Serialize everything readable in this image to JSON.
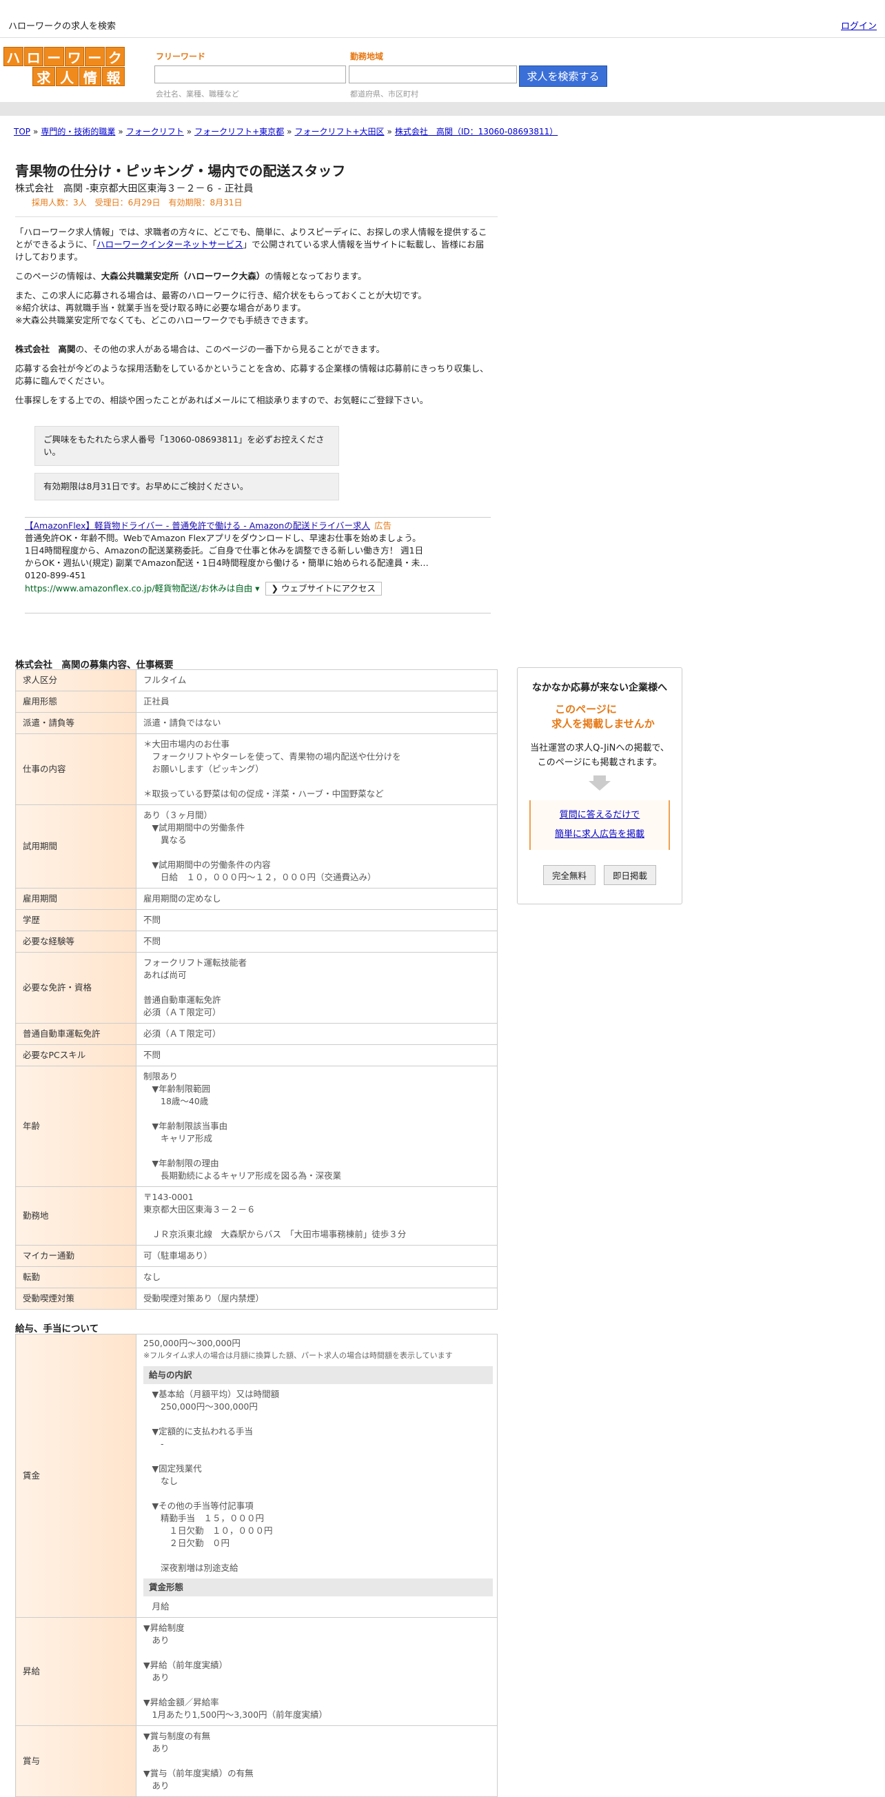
{
  "topbar": {
    "site_title": "ハローワークの求人を検索",
    "login": "ログイン"
  },
  "logo": {
    "row1": [
      "ハ",
      "ロ",
      "ー",
      "ワ",
      "ー",
      "ク"
    ],
    "row2": [
      "求",
      "人",
      "情",
      "報"
    ]
  },
  "search": {
    "freeword_label": "フリーワード",
    "freeword_hint": "会社名、業種、職種など",
    "area_label": "勤務地域",
    "area_hint": "都道府県、市区町村",
    "button": "求人を検索する"
  },
  "breadcrumb": [
    "TOP",
    "専門的・技術的職業",
    "フォークリフト",
    "フォークリフト+東京都",
    "フォークリフト+大田区",
    "株式会社　高関（ID：13060-08693811）"
  ],
  "job": {
    "title": "青果物の仕分け・ピッキング・場内での配送スタッフ",
    "subtitle": "株式会社　高関 -東京都大田区東海３－２－６ - 正社員",
    "meta": "採用人数：3人　受理日：6月29日　有効期限：8月31日"
  },
  "intro": {
    "p1a": "「ハローワーク求人情報」では、求職者の方々に、どこでも、簡単に、よりスピーディに、お探しの求人情報を提供することができるように、「",
    "p1link": "ハローワークインターネットサービス",
    "p1b": "」で公開されている求人情報を当サイトに転載し、皆様にお届けしております。",
    "p2a": "このページの情報は、",
    "p2bold": "大森公共職業安定所（ハローワーク大森）",
    "p2b": "の情報となっております。",
    "p3": "また、この求人に応募される場合は、最寄のハローワークに行き、紹介状をもらっておくことが大切です。",
    "p3b": "※紹介状は、再就職手当・就業手当を受け取る時に必要な場合があります。",
    "p3c": "※大森公共職業安定所でなくても、どこのハローワークでも手続きできます。",
    "p4bold": "株式会社　高関",
    "p4": "の、その他の求人がある場合は、このページの一番下から見ることができます。",
    "p5": "応募する会社が今どのような採用活動をしているかということを含め、応募する企業様の情報は応募前にきっちり収集し、応募に臨んでください。",
    "p6": "仕事探しをする上での、相談や困ったことがあればメールにて相談承りますので、お気軽にご登録下さい。"
  },
  "notes": {
    "n1": "ご興味をもたれたら求人番号「13060-08693811」を必ずお控えください。",
    "n2": "有効期限は8月31日です。お早めにご検討ください。"
  },
  "ad": {
    "title": "【AmazonFlex】軽貨物ドライバー - 普通免許で働ける - Amazonの配送ドライバー求人",
    "mark": "広告",
    "body1": "普通免許OK・年齢不問。WebでAmazon Flexアプリをダウンロードし、早速お仕事を始めましょう。",
    "body2": "1日4時間程度から、Amazonの配送業務委託。ご自身で仕事と休みを調整できる新しい働き方！ 週1日",
    "body3": "からOK・週払い(規定) 副業でAmazon配送・1日4時間程度から働ける・簡単に始められる配達員・未…",
    "phone": "0120-899-451",
    "url": "https://www.amazonflex.co.jp/軽貨物配送/お休みは自由",
    "visit": "ウェブサイトにアクセス"
  },
  "overview": {
    "heading": "株式会社　高関の募集内容、仕事概要",
    "rows": [
      {
        "k": "求人区分",
        "v": "フルタイム"
      },
      {
        "k": "雇用形態",
        "v": "正社員"
      },
      {
        "k": "派遣・請負等",
        "v": "派遣・請負ではない"
      },
      {
        "k": "仕事の内容",
        "v": "＊大田市場内のお仕事\n　フォークリフトやターレを使って、青果物の場内配送や仕分けを\n　お願いします（ピッキング）\n\n＊取扱っている野菜は旬の促成・洋菜・ハーブ・中国野菜など"
      },
      {
        "k": "試用期間",
        "v": "あり（３ヶ月間）\n　▼試用期間中の労働条件\n　　異なる\n\n　▼試用期間中の労働条件の内容\n　　日給　１０，０００円～１２，０００円（交通費込み）"
      },
      {
        "k": "雇用期間",
        "v": "雇用期間の定めなし"
      },
      {
        "k": "学歴",
        "v": "不問"
      },
      {
        "k": "必要な経験等",
        "v": "不問"
      },
      {
        "k": "必要な免許・資格",
        "v": "フォークリフト運転技能者\nあれば尚可\n\n普通自動車運転免許\n必須（ＡＴ限定可）"
      },
      {
        "k": "普通自動車運転免許",
        "v": "必須（ＡＴ限定可）"
      },
      {
        "k": "必要なPCスキル",
        "v": "不問"
      },
      {
        "k": "年齢",
        "v": "制限あり\n　▼年齢制限範囲\n　　18歳～40歳\n\n　▼年齢制限該当事由\n　　キャリア形成\n\n　▼年齢制限の理由\n　　長期勤続によるキャリア形成を図る為・深夜業"
      },
      {
        "k": "勤務地",
        "v": "〒143-0001\n東京都大田区東海３－２－６\n\n　ＪＲ京浜東北線　大森駅からバス　「大田市場事務棟前」徒歩３分"
      },
      {
        "k": "マイカー通勤",
        "v": "可（駐車場あり）"
      },
      {
        "k": "転勤",
        "v": "なし"
      },
      {
        "k": "受動喫煙対策",
        "v": "受動喫煙対策あり（屋内禁煙）"
      }
    ]
  },
  "salary": {
    "heading": "給与、手当について",
    "wage_key": "賃金",
    "wage_range": "250,000円〜300,000円",
    "wage_note": "※フルタイム求人の場合は月額に換算した額、パート求人の場合は時間額を表示しています",
    "breakdown_head": "給与の内訳",
    "breakdown": "　▼基本給（月額平均）又は時間額\n　　250,000円〜300,000円\n\n　▼定額的に支払われる手当\n　　-\n\n　▼固定残業代\n　　なし\n\n　▼その他の手当等付記事項\n　　精勤手当　１５，０００円\n　　　１日欠勤　１０，０００円\n　　　２日欠勤　０円\n\n　　深夜割増は別途支給",
    "form_head": "賃金形態",
    "form": "　月給",
    "raise_key": "昇給",
    "raise": "▼昇給制度\n　あり\n\n▼昇給（前年度実績）\n　あり\n\n▼昇給金額／昇給率\n　1月あたり1,500円〜3,300円（前年度実績）",
    "bonus_key": "賞与",
    "bonus": "▼賞与制度の有無\n　あり\n\n▼賞与（前年度実績）の有無\n　あり"
  },
  "sidebox": {
    "title": "なかなか応募が来ない企業様へ",
    "orange1": "このページに",
    "orange2": "求人を掲載しませんか",
    "text1": "当社運営の求人Q-JiNへの掲載で、",
    "text2": "このページにも掲載されます。",
    "link1": "質問に答えるだけで",
    "link2": "簡単に求人広告を掲載",
    "btn1": "完全無料",
    "btn2": "即日掲載"
  }
}
